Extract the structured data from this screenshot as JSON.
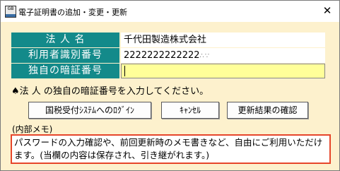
{
  "window": {
    "title": "電子証明書の追加・変更・更新",
    "close_glyph": "✕"
  },
  "form": {
    "corp_name_label": "法 人 名",
    "corp_name_value": "千代田製造株式会社",
    "user_id_label": "利用者識別番号",
    "user_id_value": "2222222222222",
    "pin_label": "独自の暗証番号",
    "pin_value": ""
  },
  "instruction": "♠法 人 の独自の暗証番号を入力してください。",
  "buttons": {
    "login": "国税受付ｼｽﾃﾑへのﾛｸﾞｲﾝ",
    "cancel": "ｷｬﾝｾﾙ",
    "confirm": "更新結果の確認"
  },
  "memo": {
    "label": "(内部メモ)",
    "text": "パスワードの入力確認や、前回更新時のメモ書きなど、自由にご利用いただけます。(当欄の内容は保存され、引き継がれます。)"
  }
}
